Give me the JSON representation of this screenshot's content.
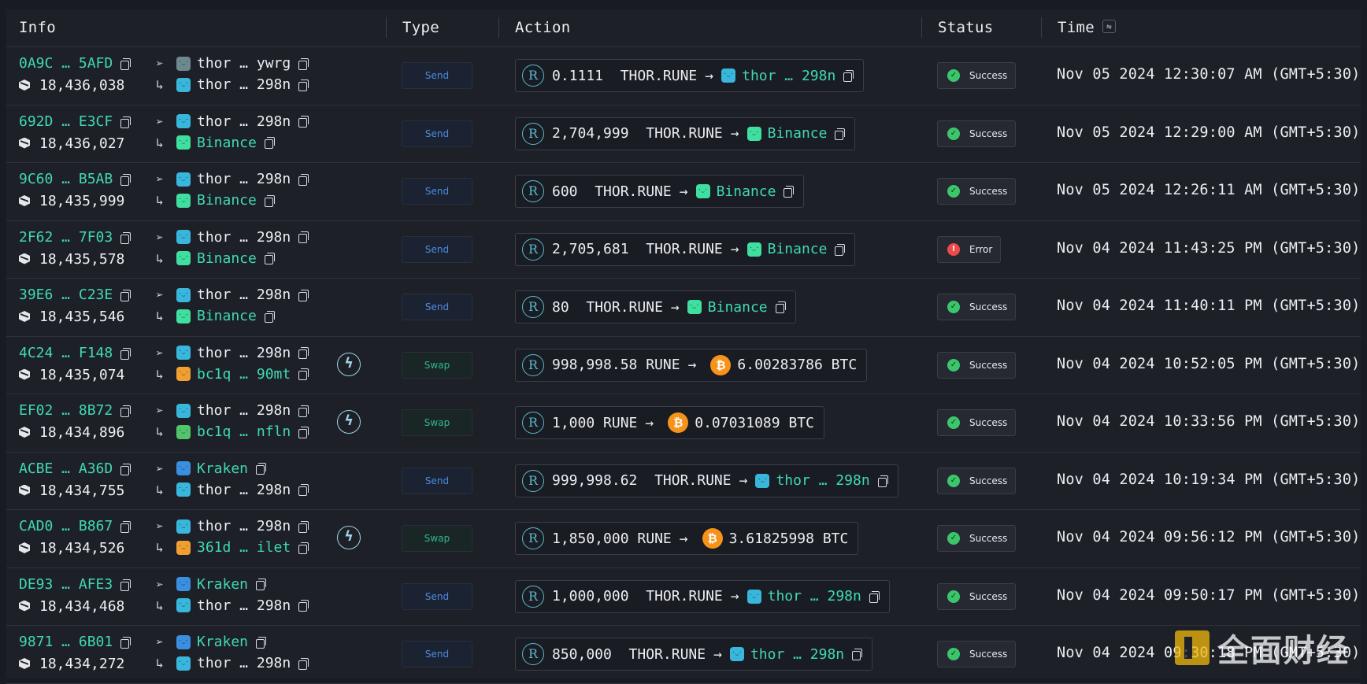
{
  "columns": {
    "info": "Info",
    "type": "Type",
    "action": "Action",
    "status": "Status",
    "time": "Time",
    "sort_icon": "swap-horizontal-icon"
  },
  "colors": {
    "accent": "#3fd9b2",
    "send": "#4d8be0",
    "swap": "#2fb594",
    "success": "#3cc66b",
    "error": "#ef4a4a",
    "btc": "#f7931a"
  },
  "rows": [
    {
      "hash": "0A9C … 5AFD",
      "block": "18,436,038",
      "from": "thor … ywrg",
      "from_color": "white",
      "from_avatar": "#6c8a8d",
      "to": "thor … 298n",
      "to_color": "white",
      "to_avatar": "#38b6dc",
      "swap": false,
      "type": "Send",
      "amount": "0.1111",
      "asset": "THOR.RUNE",
      "dest": "thor … 298n",
      "dest_avatar": "#38b6dc",
      "out_amount": "",
      "out_asset": "",
      "status": "Success",
      "time": "Nov 05 2024 12:30:07 AM (GMT+5:30)"
    },
    {
      "hash": "692D … E3CF",
      "block": "18,436,027",
      "from": "thor … 298n",
      "from_color": "white",
      "from_avatar": "#38b6dc",
      "to": "Binance",
      "to_color": "green",
      "to_avatar": "#3fdf9f",
      "swap": false,
      "type": "Send",
      "amount": "2,704,999",
      "asset": "THOR.RUNE",
      "dest": "Binance",
      "dest_avatar": "#3fdf9f",
      "out_amount": "",
      "out_asset": "",
      "status": "Success",
      "time": "Nov 05 2024 12:29:00 AM (GMT+5:30)"
    },
    {
      "hash": "9C60 … B5AB",
      "block": "18,435,999",
      "from": "thor … 298n",
      "from_color": "white",
      "from_avatar": "#38b6dc",
      "to": "Binance",
      "to_color": "green",
      "to_avatar": "#3fdf9f",
      "swap": false,
      "type": "Send",
      "amount": "600",
      "asset": "THOR.RUNE",
      "dest": "Binance",
      "dest_avatar": "#3fdf9f",
      "out_amount": "",
      "out_asset": "",
      "status": "Success",
      "time": "Nov 05 2024 12:26:11 AM (GMT+5:30)"
    },
    {
      "hash": "2F62 … 7F03",
      "block": "18,435,578",
      "from": "thor … 298n",
      "from_color": "white",
      "from_avatar": "#38b6dc",
      "to": "Binance",
      "to_color": "green",
      "to_avatar": "#3fdf9f",
      "swap": false,
      "type": "Send",
      "amount": "2,705,681",
      "asset": "THOR.RUNE",
      "dest": "Binance",
      "dest_avatar": "#3fdf9f",
      "out_amount": "",
      "out_asset": "",
      "status": "Error",
      "time": "Nov 04 2024 11:43:25 PM (GMT+5:30)"
    },
    {
      "hash": "39E6 … C23E",
      "block": "18,435,546",
      "from": "thor … 298n",
      "from_color": "white",
      "from_avatar": "#38b6dc",
      "to": "Binance",
      "to_color": "green",
      "to_avatar": "#3fdf9f",
      "swap": false,
      "type": "Send",
      "amount": "80",
      "asset": "THOR.RUNE",
      "dest": "Binance",
      "dest_avatar": "#3fdf9f",
      "out_amount": "",
      "out_asset": "",
      "status": "Success",
      "time": "Nov 04 2024 11:40:11 PM (GMT+5:30)"
    },
    {
      "hash": "4C24 … F148",
      "block": "18,435,074",
      "from": "thor … 298n",
      "from_color": "white",
      "from_avatar": "#38b6dc",
      "to": "bc1q … 90mt",
      "to_color": "green",
      "to_avatar": "#f0a030",
      "swap": true,
      "type": "Swap",
      "amount": "998,998.58",
      "asset": "RUNE",
      "dest": "",
      "dest_avatar": "",
      "out_amount": "6.00283786",
      "out_asset": "BTC",
      "status": "Success",
      "time": "Nov 04 2024 10:52:05 PM (GMT+5:30)"
    },
    {
      "hash": "EF02 … 8B72",
      "block": "18,434,896",
      "from": "thor … 298n",
      "from_color": "white",
      "from_avatar": "#38b6dc",
      "to": "bc1q … nfln",
      "to_color": "green",
      "to_avatar": "#52c46a",
      "swap": true,
      "type": "Swap",
      "amount": "1,000",
      "asset": "RUNE",
      "dest": "",
      "dest_avatar": "",
      "out_amount": "0.07031089",
      "out_asset": "BTC",
      "status": "Success",
      "time": "Nov 04 2024 10:33:56 PM (GMT+5:30)"
    },
    {
      "hash": "ACBE … A36D",
      "block": "18,434,755",
      "from": "Kraken",
      "from_color": "green",
      "from_avatar": "#3a8fe0",
      "to": "thor … 298n",
      "to_color": "white",
      "to_avatar": "#38b6dc",
      "swap": false,
      "type": "Send",
      "amount": "999,998.62",
      "asset": "THOR.RUNE",
      "dest": "thor … 298n",
      "dest_avatar": "#38b6dc",
      "out_amount": "",
      "out_asset": "",
      "status": "Success",
      "time": "Nov 04 2024 10:19:34 PM (GMT+5:30)"
    },
    {
      "hash": "CAD0 … B867",
      "block": "18,434,526",
      "from": "thor … 298n",
      "from_color": "white",
      "from_avatar": "#38b6dc",
      "to": "361d … ilet",
      "to_color": "green",
      "to_avatar": "#f0a030",
      "swap": true,
      "type": "Swap",
      "amount": "1,850,000",
      "asset": "RUNE",
      "dest": "",
      "dest_avatar": "",
      "out_amount": "3.61825998",
      "out_asset": "BTC",
      "status": "Success",
      "time": "Nov 04 2024 09:56:12 PM (GMT+5:30)"
    },
    {
      "hash": "DE93 … AFE3",
      "block": "18,434,468",
      "from": "Kraken",
      "from_color": "green",
      "from_avatar": "#3a8fe0",
      "to": "thor … 298n",
      "to_color": "white",
      "to_avatar": "#38b6dc",
      "swap": false,
      "type": "Send",
      "amount": "1,000,000",
      "asset": "THOR.RUNE",
      "dest": "thor … 298n",
      "dest_avatar": "#38b6dc",
      "out_amount": "",
      "out_asset": "",
      "status": "Success",
      "time": "Nov 04 2024 09:50:17 PM (GMT+5:30)"
    },
    {
      "hash": "9871 … 6B01",
      "block": "18,434,272",
      "from": "Kraken",
      "from_color": "green",
      "from_avatar": "#3a8fe0",
      "to": "thor … 298n",
      "to_color": "white",
      "to_avatar": "#38b6dc",
      "swap": false,
      "type": "Send",
      "amount": "850,000",
      "asset": "THOR.RUNE",
      "dest": "thor … 298n",
      "dest_avatar": "#38b6dc",
      "out_amount": "",
      "out_asset": "",
      "status": "Success",
      "time": "Nov 04 2024 09:30:18 PM (GMT+5:30)"
    }
  ],
  "watermark": {
    "text": "全面财经"
  }
}
